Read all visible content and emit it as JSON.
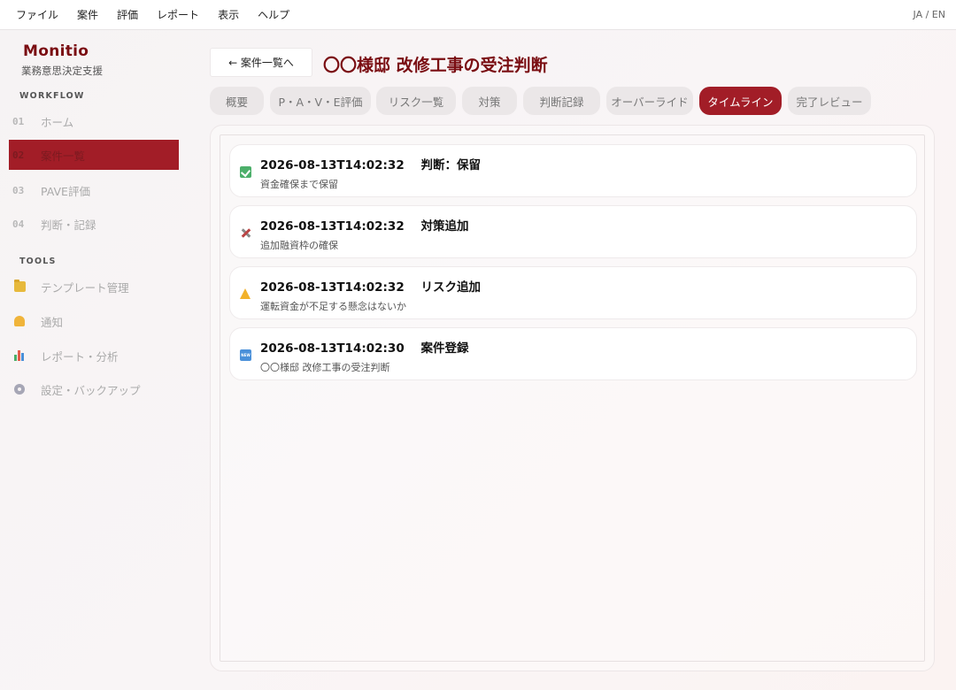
{
  "menubar": {
    "items": [
      "ファイル",
      "案件",
      "評価",
      "レポート",
      "表示",
      "ヘルプ"
    ],
    "lang": "JA / EN"
  },
  "sidebar": {
    "brand": "Monitio",
    "subtitle": "業務意思決定支援",
    "workflow_label": "WORKFLOW",
    "workflow": [
      {
        "num": "01",
        "label": "ホーム"
      },
      {
        "num": "02",
        "label": "案件一覧",
        "active": true
      },
      {
        "num": "03",
        "label": "PAVE評価"
      },
      {
        "num": "04",
        "label": "判断・記録"
      }
    ],
    "tools_label": "TOOLS",
    "tools": [
      {
        "icon": "folder-icon",
        "label": "テンプレート管理"
      },
      {
        "icon": "bell-icon",
        "label": "通知"
      },
      {
        "icon": "bar-chart-icon",
        "label": "レポート・分析"
      },
      {
        "icon": "gear-icon",
        "label": "設定・バックアップ"
      }
    ]
  },
  "header": {
    "back_label": "← 案件一覧へ",
    "title": "〇〇様邸 改修工事の受注判断"
  },
  "tabs": [
    {
      "label": "概要"
    },
    {
      "label": "P・A・V・E評価"
    },
    {
      "label": "リスク一覧"
    },
    {
      "label": "対策"
    },
    {
      "label": "判断記録"
    },
    {
      "label": "オーバーライド"
    },
    {
      "label": "タイムライン",
      "active": true
    },
    {
      "label": "完了レビュー"
    }
  ],
  "timeline": [
    {
      "icon": "check-icon",
      "timestamp": "2026-08-13T14:02:32",
      "event": "判断：保留",
      "detail": "資金確保まで保留"
    },
    {
      "icon": "tools-icon",
      "timestamp": "2026-08-13T14:02:32",
      "event": "対策追加",
      "detail": "追加融資枠の確保"
    },
    {
      "icon": "warning-icon",
      "timestamp": "2026-08-13T14:02:32",
      "event": "リスク追加",
      "detail": "運転資金が不足する懸念はないか"
    },
    {
      "icon": "new-icon",
      "timestamp": "2026-08-13T14:02:30",
      "event": "案件登録",
      "detail": "〇〇様邸 改修工事の受注判断"
    }
  ],
  "colors": {
    "accent": "#a21d27",
    "brand": "#7a0d12"
  }
}
